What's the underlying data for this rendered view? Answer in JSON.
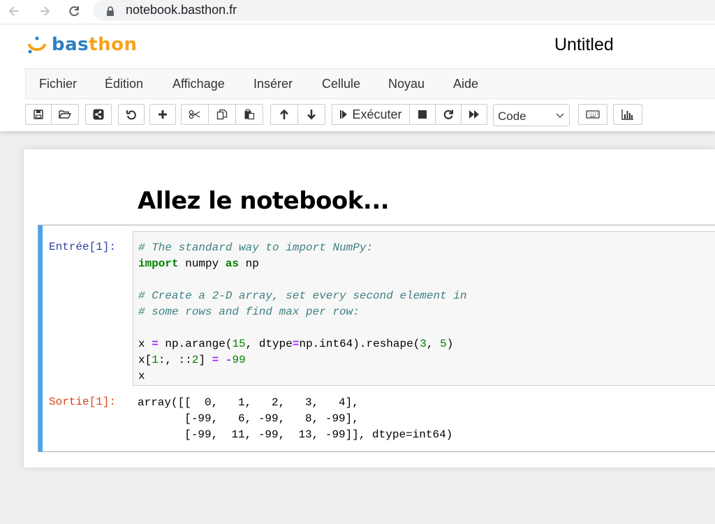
{
  "browser": {
    "url": "notebook.basthon.fr"
  },
  "header": {
    "logo_part1": "bas",
    "logo_part2": "thon",
    "title": "Untitled"
  },
  "menu": {
    "items": [
      "Fichier",
      "Édition",
      "Affichage",
      "Insérer",
      "Cellule",
      "Noyau",
      "Aide"
    ]
  },
  "toolbar": {
    "run_label": "Exécuter",
    "cell_type": "Code"
  },
  "notebook": {
    "heading": "Allez le notebook...",
    "cell": {
      "in_prompt": "Entrée[1]:",
      "out_prompt": "Sortie[1]:",
      "code_lines": [
        "# The standard way to import NumPy:",
        "import numpy as np",
        "",
        "# Create a 2-D array, set every second element in",
        "# some rows and find max per row:",
        "",
        "x = np.arange(15, dtype=np.int64).reshape(3, 5)",
        "x[1:, ::2] = -99",
        "x"
      ],
      "output_lines": [
        "array([[  0,   1,   2,   3,   4],",
        "       [-99,   6, -99,   8, -99],",
        "       [-99,  11, -99,  13, -99]], dtype=int64)"
      ]
    }
  },
  "colors": {
    "accent_bar": "#42a5f5",
    "in_prompt": "#303f9f",
    "out_prompt": "#d84315",
    "comment": "#408080",
    "keyword": "#008000",
    "operator": "#aa22ff"
  }
}
